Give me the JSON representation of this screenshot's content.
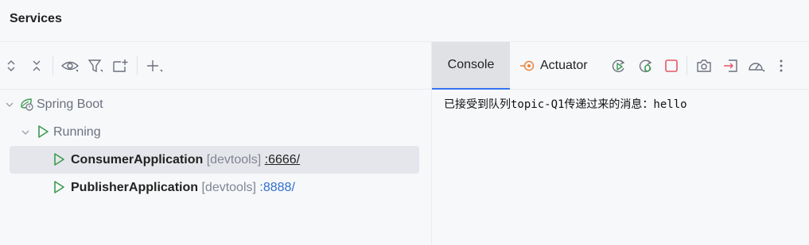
{
  "window": {
    "title": "Services"
  },
  "left_toolbar": {
    "icons": [
      "expand-all-icon",
      "collapse-all-icon",
      "eye-icon",
      "filter-icon",
      "new-group-icon",
      "add-icon"
    ]
  },
  "tree": {
    "root": {
      "label": "Spring Boot",
      "icon": "spring-boot-icon"
    },
    "group": {
      "label": "Running",
      "icon": "run-icon"
    },
    "items": [
      {
        "name": "ConsumerApplication",
        "tag": "[devtools]",
        "port": ":6666/",
        "selected": true
      },
      {
        "name": "PublisherApplication",
        "tag": "[devtools]",
        "port": ":8888/",
        "selected": false
      }
    ]
  },
  "right_toolbar": {
    "tabs": [
      {
        "label": "Console",
        "active": true
      },
      {
        "label": "Actuator",
        "active": false
      }
    ],
    "icons": [
      "rerun-icon",
      "rerun-debug-icon",
      "stop-icon",
      "screenshot-icon",
      "exit-icon",
      "dashboard-icon",
      "more-options-icon"
    ]
  },
  "console": {
    "lines": [
      "已接受到队列topic-Q1传递过来的消息：hello"
    ]
  },
  "colors": {
    "accent": "#3574f0",
    "run_green": "#3d9a50",
    "stop_red": "#e55765",
    "link_blue": "#2f6fd0",
    "actuator_orange": "#e8843b"
  }
}
